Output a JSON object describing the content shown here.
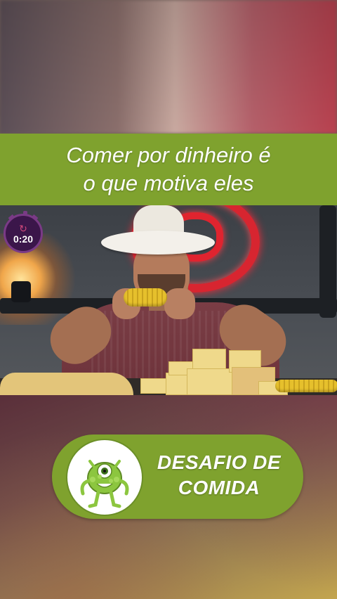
{
  "caption": {
    "line1": "Comer por dinheiro é",
    "line2": "o que motiva eles",
    "band_color": "#7fa22e"
  },
  "timer": {
    "value": "0:20",
    "icon": "stopwatch-icon"
  },
  "badge": {
    "line1": "DESAFIO DE",
    "line2": "COMIDA",
    "logo_icon": "green-monster-icon",
    "color": "#7fa22e"
  },
  "video": {
    "scene": "video-frame"
  }
}
